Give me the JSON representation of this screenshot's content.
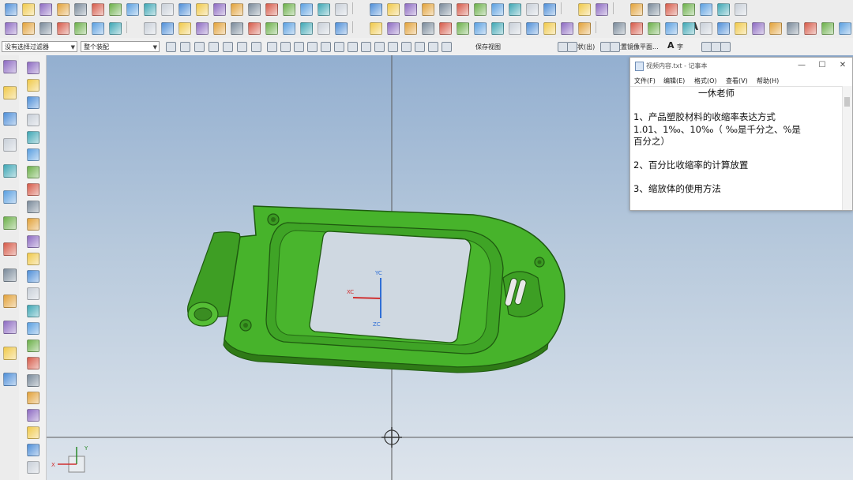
{
  "toolbar": {
    "filter_dropdown": "没有选择过滤器",
    "assembly_dropdown": "整个装配",
    "save_view_label": "保存视图",
    "shape_label": "形状(出)",
    "wcs_label": "设置镜像平面...",
    "text_tool_label": "A",
    "text_tool_label2": "A",
    "char_label": "字"
  },
  "viewport": {
    "axis_x": "XC",
    "axis_y": "YC",
    "axis_z": "ZC",
    "mini_axis_x": "X",
    "mini_axis_y": "Y"
  },
  "notepad": {
    "title": "视频内容.txt - 记事本",
    "menu": [
      "文件(F)",
      "编辑(E)",
      "格式(O)",
      "查看(V)",
      "帮助(H)"
    ],
    "lines": [
      "一休老师",
      "",
      "1、产品塑胶材料的收缩率表达方式",
      "1.01、1‰、10‰（ ‰是千分之、%是",
      "百分之）",
      "",
      "2、百分比收缩率的计算放置",
      "",
      "3、缩放体的使用方法"
    ],
    "minimize": "—",
    "maximize": "☐",
    "close": "✕"
  },
  "colors": {
    "part_green": "#47b32b",
    "part_dark": "#2f7a17",
    "accent_blue": "#2f6fd6"
  }
}
